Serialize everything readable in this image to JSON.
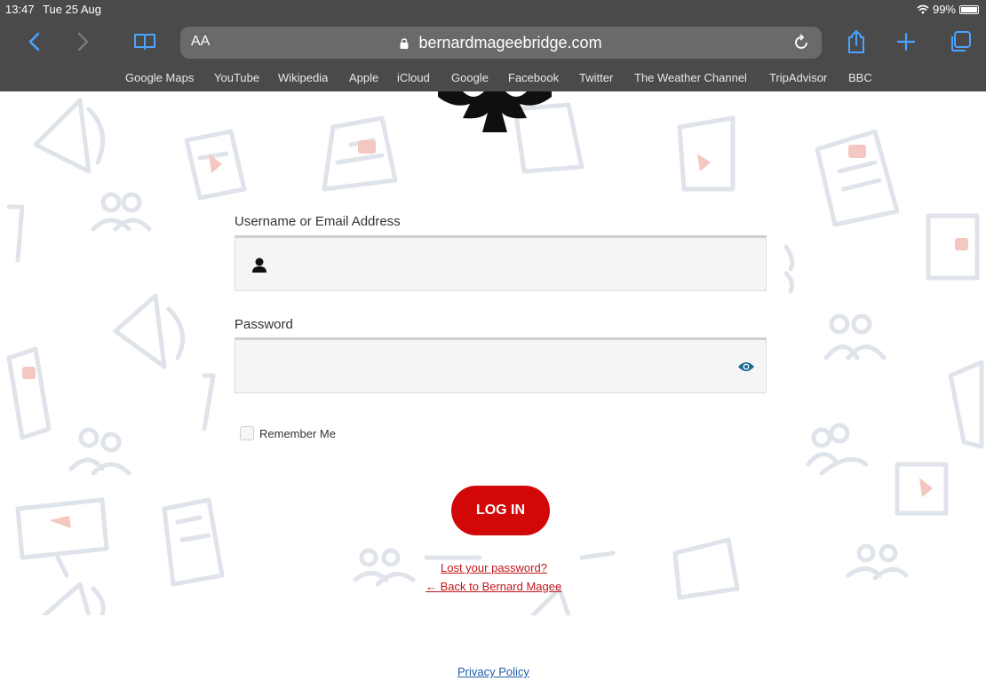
{
  "status_bar": {
    "time": "13:47",
    "date": "Tue 25 Aug",
    "battery": "99%"
  },
  "browser": {
    "aa_label": "AA",
    "url": "bernardmageebridge.com",
    "favorites": [
      "Google Maps",
      "YouTube",
      "Wikipedia",
      "Apple",
      "iCloud",
      "Google",
      "Facebook",
      "Twitter",
      "The Weather Channel",
      "TripAdvisor",
      "BBC"
    ]
  },
  "login": {
    "username_label": "Username or Email Address",
    "username_value": "",
    "password_label": "Password",
    "password_value": "",
    "remember_label": "Remember Me",
    "remember_checked": false,
    "login_button": "LOG IN",
    "lost_password": "Lost your password?",
    "back_link": "← Back to Bernard Magee"
  },
  "footer": {
    "privacy_policy": "Privacy Policy"
  },
  "colors": {
    "chrome": "#4a4a4a",
    "accent_red": "#d20707",
    "link_red": "#c0161b",
    "link_blue": "#1e5ea8",
    "eye_icon": "#1b6b92"
  },
  "icons": {
    "nav": [
      "chevron-left-icon",
      "chevron-right-icon",
      "book-icon",
      "lock-icon",
      "reload-icon",
      "share-icon",
      "plus-icon",
      "tabs-icon"
    ],
    "fields": [
      "user-icon",
      "eye-icon"
    ],
    "status": [
      "wifi-icon",
      "battery-icon"
    ]
  }
}
